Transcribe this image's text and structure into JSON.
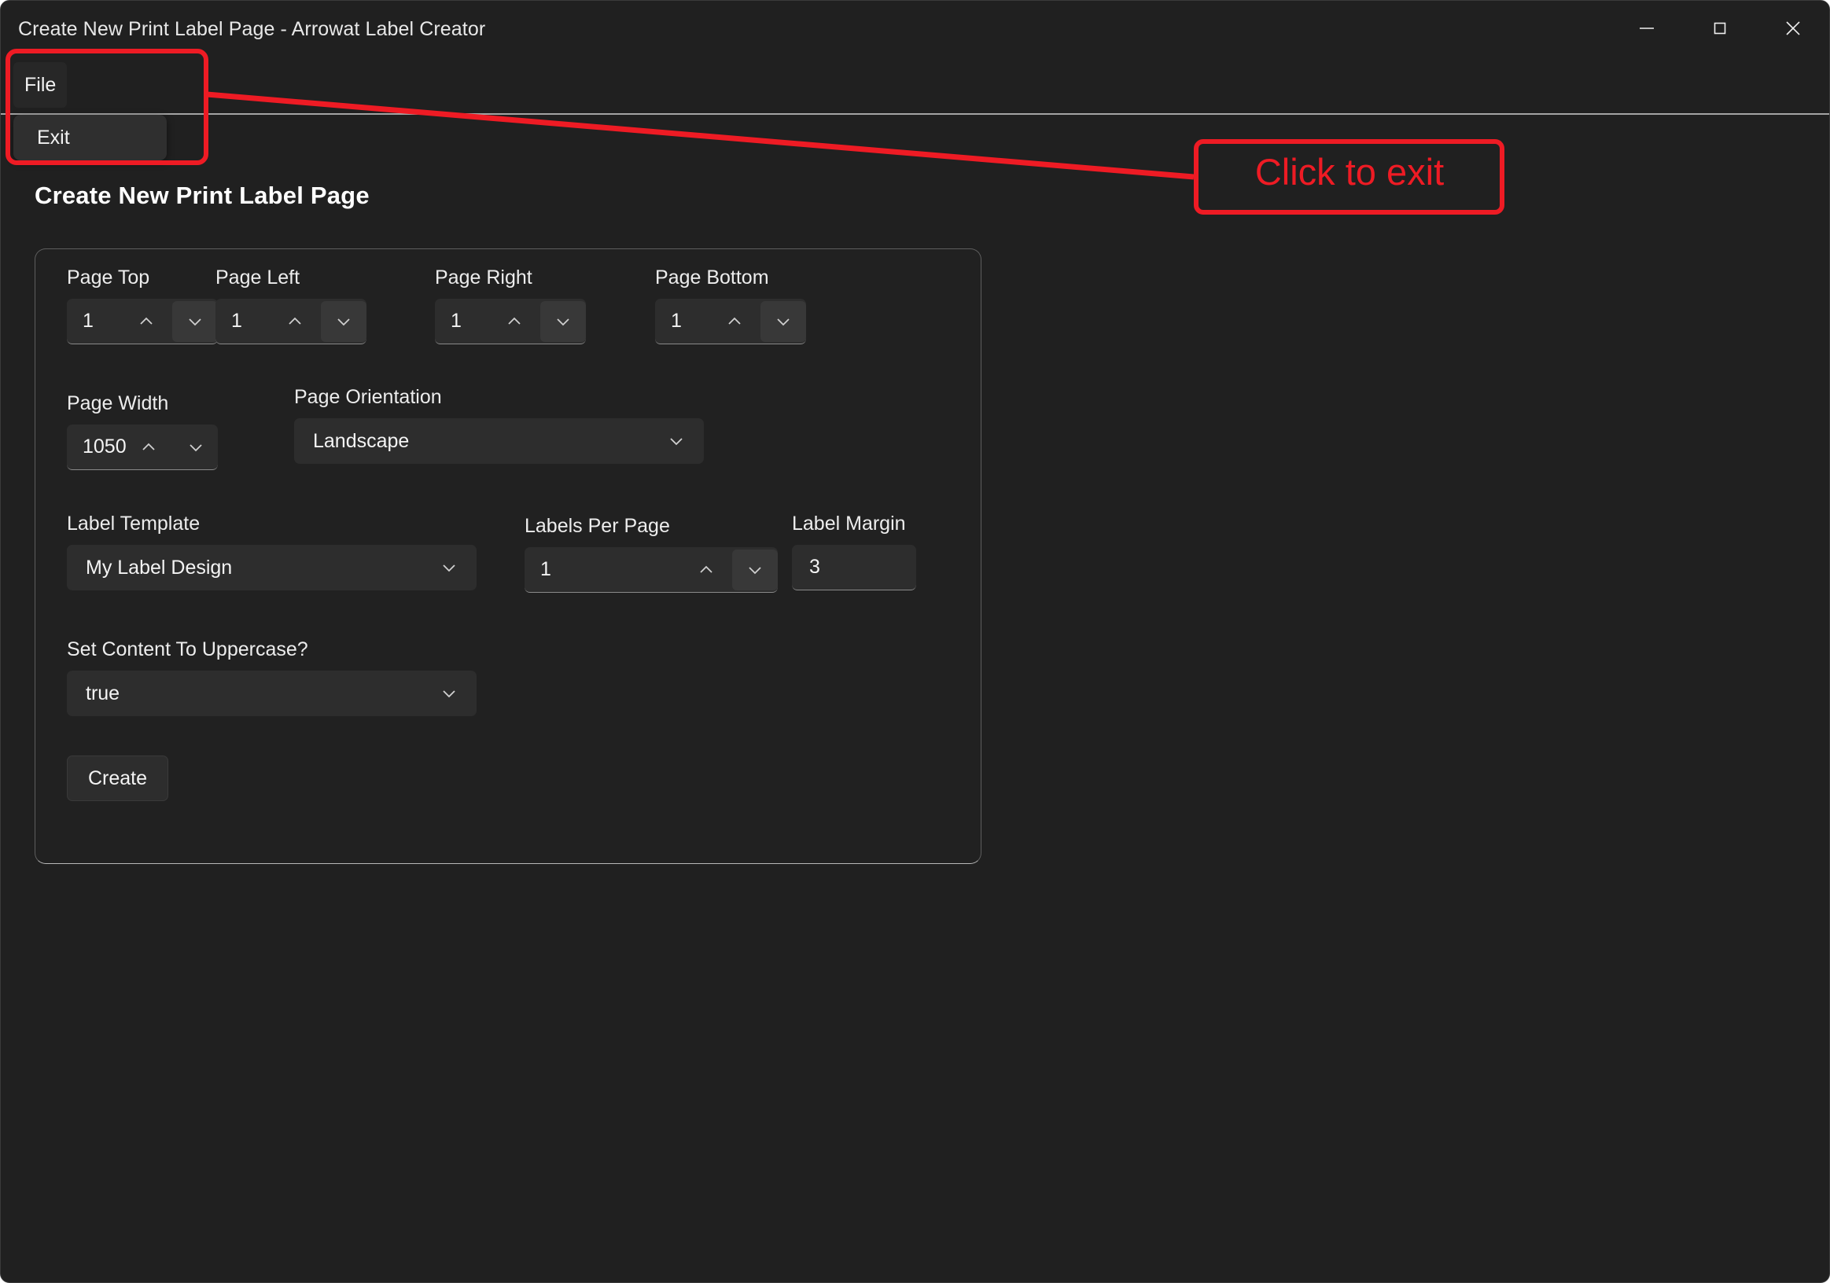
{
  "window": {
    "title": "Create New Print Label Page - Arrowat Label Creator",
    "caption_buttons": [
      {
        "name": "minimize",
        "glyph": "minimize-icon"
      },
      {
        "name": "maximize",
        "glyph": "maximize-icon"
      },
      {
        "name": "close",
        "glyph": "close-icon"
      }
    ]
  },
  "menubar": {
    "file_label": "File",
    "open_menu": {
      "items": [
        {
          "label": "Exit"
        }
      ]
    }
  },
  "page": {
    "heading": "Create New Print Label Page"
  },
  "form": {
    "page_top": {
      "label": "Page Top",
      "value": "1"
    },
    "page_left": {
      "label": "Page Left",
      "value": "1"
    },
    "page_right": {
      "label": "Page Right",
      "value": "1"
    },
    "page_bottom": {
      "label": "Page Bottom",
      "value": "1"
    },
    "page_width": {
      "label": "Page Width",
      "value": "1050"
    },
    "page_orientation": {
      "label": "Page Orientation",
      "value": "Landscape"
    },
    "label_template": {
      "label": "Label Template",
      "value": "My Label Design"
    },
    "labels_per_page": {
      "label": "Labels Per Page",
      "value": "1"
    },
    "label_margin": {
      "label": "Label Margin",
      "value": "3"
    },
    "set_content_uppercase": {
      "label": "Set Content To Uppercase?",
      "value": "true"
    },
    "create_button": {
      "label": "Create"
    }
  },
  "annotation": {
    "callout_text": "Click to exit",
    "color": "#ee1b24"
  }
}
